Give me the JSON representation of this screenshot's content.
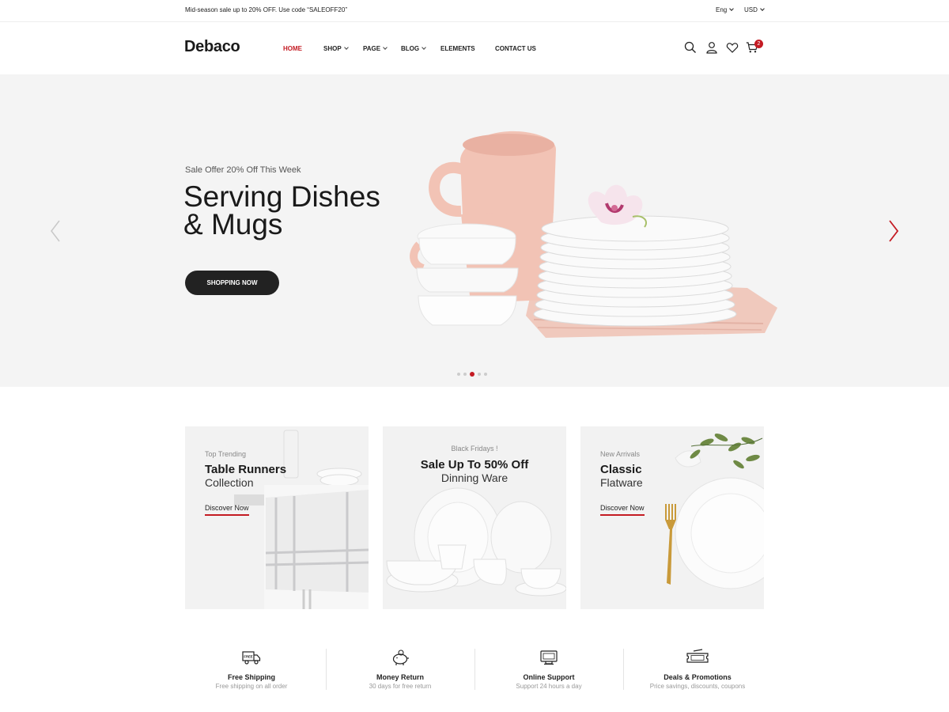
{
  "topbar": {
    "promo": "Mid-season sale up to 20% OFF. Use code “SALEOFF20”",
    "language": "Eng",
    "currency": "USD"
  },
  "header": {
    "logo": "Debaco",
    "nav": [
      {
        "label": "HOME"
      },
      {
        "label": "SHOP"
      },
      {
        "label": "PAGE"
      },
      {
        "label": "BLOG"
      },
      {
        "label": "ELEMENTS"
      },
      {
        "label": "CONTACT US"
      }
    ],
    "icons": [
      "search-icon",
      "user-icon",
      "heart-icon",
      "cart-icon"
    ],
    "cart_count": "2"
  },
  "hero": {
    "subtitle": "Sale Offer 20% Off This Week",
    "title_line1": "Serving Dishes",
    "title_line2": "& Mugs",
    "cta": "SHOPPING NOW",
    "slide_count": 5,
    "active_slide": 3,
    "accent_color": "#c41b23"
  },
  "banners": [
    {
      "subtitle": "Top Trending",
      "title": "Table Runners",
      "title2": "Collection",
      "link": "Discover Now"
    },
    {
      "subtitle": "Black Fridays !",
      "title": "Sale Up To 50% Off",
      "title2": "Dinning Ware"
    },
    {
      "subtitle": "New Arrivals",
      "title": "Classic",
      "title2": "Flatware",
      "link": "Discover Now"
    }
  ],
  "features": [
    {
      "icon": "truck-icon",
      "badge": "FREE",
      "title": "Free Shipping",
      "subtitle": "Free shipping on all order"
    },
    {
      "icon": "piggy-bank-icon",
      "title": "Money Return",
      "subtitle": "30 days for free return"
    },
    {
      "icon": "support-icon",
      "title": "Online Support",
      "subtitle": "Support 24 hours a day"
    },
    {
      "icon": "coupon-icon",
      "title": "Deals & Promotions",
      "subtitle": "Price savings, discounts, coupons"
    }
  ]
}
